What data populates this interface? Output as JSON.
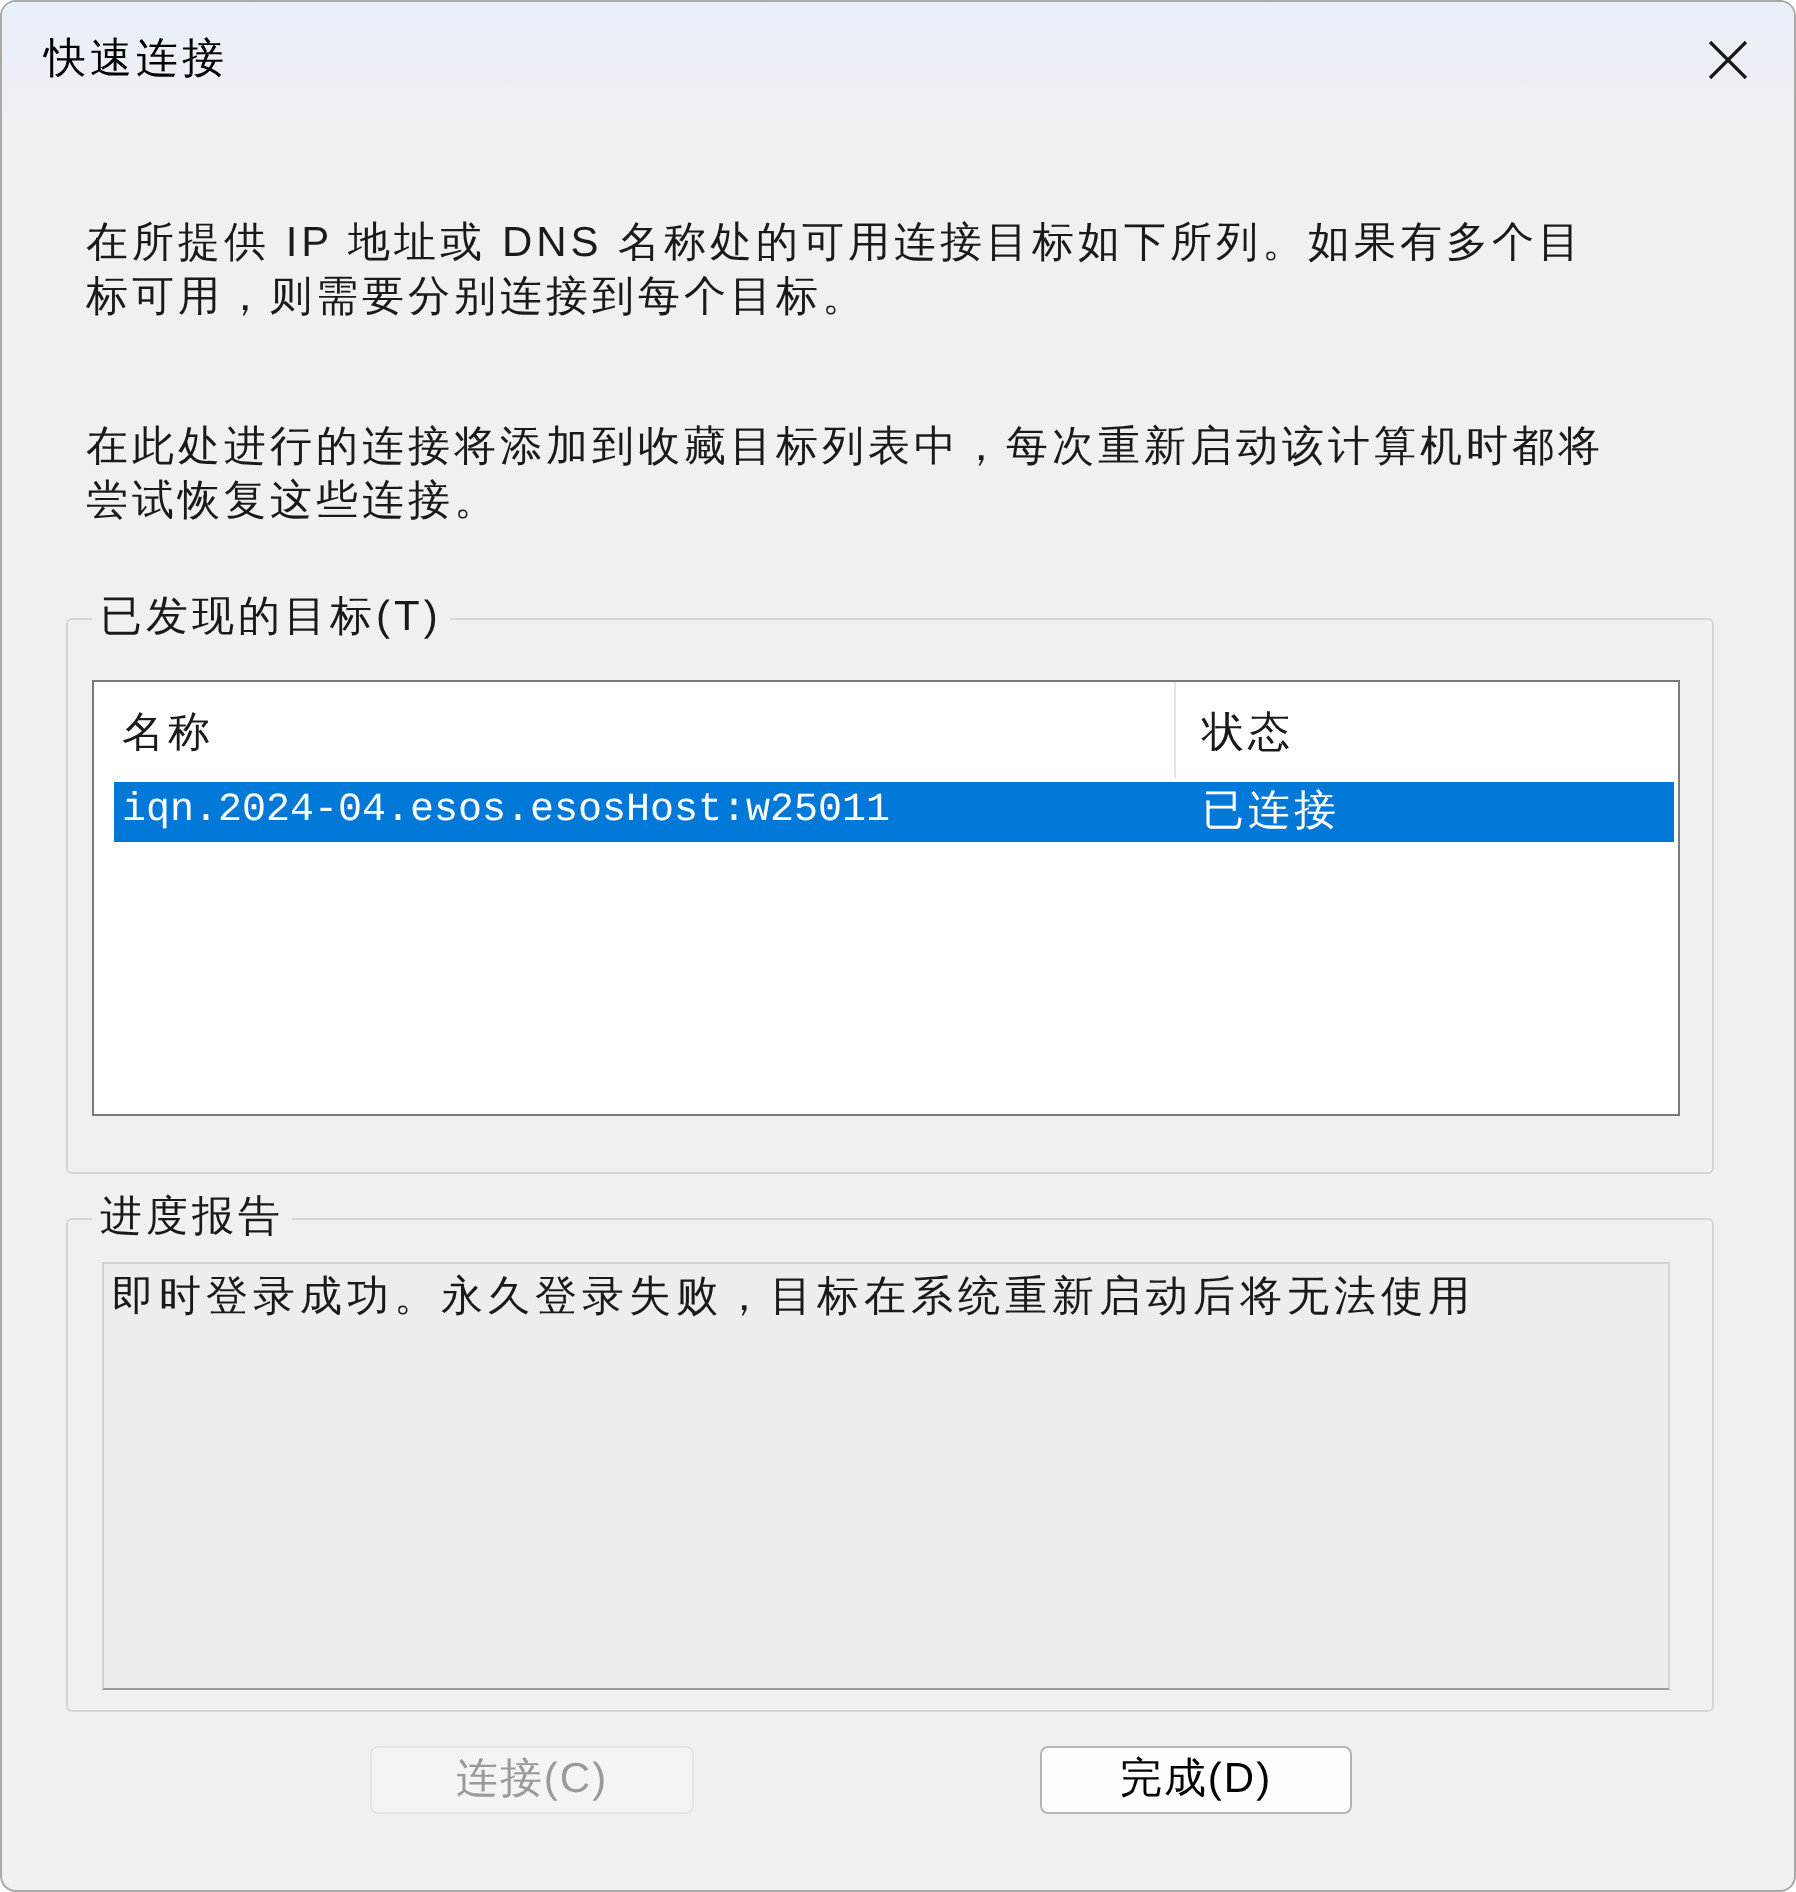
{
  "window": {
    "title": "快速连接"
  },
  "intro": [
    "在所提供 IP 地址或 DNS 名称处的可用连接目标如下所列。如果有多个目标可用，则需要分别连接到每个目标。",
    "在此处进行的连接将添加到收藏目标列表中，每次重新启动该计算机时都将尝试恢复这些连接。"
  ],
  "discovered_targets": {
    "label": "已发现的目标(T)",
    "columns": [
      "名称",
      "状态"
    ],
    "rows": [
      {
        "cells": [
          "iqn.2024-04.esos.esosHost:w25011",
          "已连接"
        ],
        "selected": true
      }
    ]
  },
  "progress_report": {
    "label": "进度报告",
    "text": "即时登录成功。永久登录失败，目标在系统重新启动后将无法使用"
  },
  "buttons": [
    {
      "label": "连接(C)",
      "disabled": true
    },
    {
      "label": "完成(D)",
      "disabled": false
    }
  ]
}
